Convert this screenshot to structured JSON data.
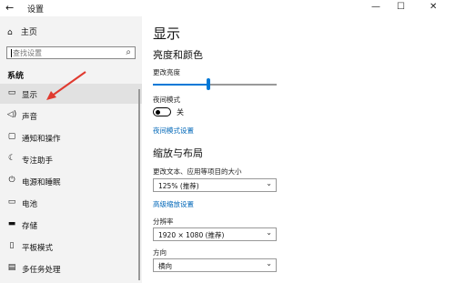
{
  "window": {
    "title": "设置",
    "back_glyph": "←",
    "minimize_glyph": "—",
    "maximize_glyph": "☐",
    "close_glyph": "✕"
  },
  "sidebar": {
    "home_label": "主页",
    "search_placeholder": "查找设置",
    "section": "系统",
    "items": [
      {
        "label": "显示",
        "icon": "monitor-icon",
        "glyph": "▭",
        "selected": true
      },
      {
        "label": "声音",
        "icon": "speaker-icon",
        "glyph": "◁)"
      },
      {
        "label": "通知和操作",
        "icon": "notification-icon",
        "glyph": "▢"
      },
      {
        "label": "专注助手",
        "icon": "moon-icon",
        "glyph": "☾"
      },
      {
        "label": "电源和睡眠",
        "icon": "power-icon",
        "glyph": "⏻"
      },
      {
        "label": "电池",
        "icon": "battery-icon",
        "glyph": "▭"
      },
      {
        "label": "存储",
        "icon": "storage-icon",
        "glyph": "▬"
      },
      {
        "label": "平板模式",
        "icon": "tablet-icon",
        "glyph": "▯"
      },
      {
        "label": "多任务处理",
        "icon": "multitask-icon",
        "glyph": "▤"
      }
    ]
  },
  "main": {
    "title": "显示",
    "brightness_heading": "亮度和颜色",
    "brightness_label": "更改亮度",
    "brightness_level": 0.45,
    "night_mode_label": "夜间模式",
    "night_mode_state": "关",
    "night_mode_link": "夜间模式设置",
    "scale_heading": "缩放与布局",
    "scale_label": "更改文本、应用等项目的大小",
    "scale_value": "125% (推荐)",
    "advanced_scale_link": "高级缩放设置",
    "resolution_label": "分辨率",
    "resolution_value": "1920 × 1080 (推荐)",
    "orientation_label": "方向",
    "orientation_value": "横向"
  },
  "colors": {
    "accent": "#0078d7",
    "link": "#0067b8",
    "sidebar_bg": "#f3f3f3",
    "selected_bg": "#e1e1e1",
    "arrow": "#e03a2f"
  }
}
